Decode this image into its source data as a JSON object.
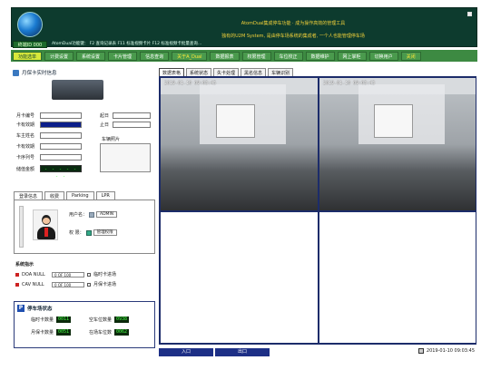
{
  "header": {
    "device_id": "终端ID 000",
    "banner_line1": "AtomDual集成停车功能 · 成为操作高效的管理工具",
    "banner_line2": "独有的U2M System, 是由停车场系统的集成者, 一个人也能管理停车场",
    "ticker": "AtomDual功能键：  F2 查询记录表  F11 标准视频卡片   F12 标准视频卡批量查询..."
  },
  "nav": {
    "items": [
      {
        "label": "功能选单",
        "state": "active"
      },
      {
        "label": "计费设置",
        "state": "normal"
      },
      {
        "label": "系统设置",
        "state": "normal"
      },
      {
        "label": "卡片管理",
        "state": "normal"
      },
      {
        "label": "信息查询",
        "state": "normal"
      },
      {
        "label": "关于A_Dual",
        "state": "yellow"
      },
      {
        "label": "数据报表",
        "state": "normal"
      },
      {
        "label": "权限管理",
        "state": "normal"
      },
      {
        "label": "车位校正",
        "state": "normal"
      },
      {
        "label": "数据维护",
        "state": "normal"
      },
      {
        "label": "网上掌柜",
        "state": "normal"
      },
      {
        "label": "切换用户",
        "state": "normal"
      },
      {
        "label": "关闭",
        "state": "yellow"
      }
    ]
  },
  "left": {
    "section_title": "月保卡实时信息",
    "fields": {
      "card_no": "月卡编号",
      "card_status": "卡有效期",
      "owner": "车主姓名",
      "valid": "卡有效期",
      "serial": "卡序列号",
      "balance": "储值金额",
      "start": "起日",
      "end": "止日",
      "photo": "车辆照片",
      "balance_value": "- - - - - - -"
    },
    "tabs": [
      "登录信息",
      "收费",
      "Parking",
      "LPR"
    ],
    "login": {
      "user_label": "用户名：",
      "user_value": "ADMIN",
      "perm_label": "权  限：",
      "perm_value": "管理权限"
    },
    "system": {
      "title": "系统指示",
      "rows": [
        {
          "name": "DOA NULL",
          "value": "0 OF 100",
          "check": "临时卡进场"
        },
        {
          "name": "CAV NULL",
          "value": "0 OF 100",
          "check": "月保卡进场"
        }
      ]
    },
    "parking": {
      "title": "停车场状态",
      "temp_in_label": "临时卡数量",
      "temp_in": "0011",
      "space_label": "空车位数量",
      "space": "0938",
      "month_label": "月保卡数量",
      "month": "0051",
      "occupied_label": "在场车位数",
      "occupied": "0062"
    }
  },
  "cameras": {
    "tabs": [
      "数据表格",
      "系统状态",
      "失卡处理",
      "黑名信息",
      "车辆识别"
    ],
    "cam1_ts": "2019-01-10 09:03:45",
    "cam2_ts": "2019-01-10 09:03:43"
  },
  "bottom": {
    "entry": "入口",
    "exit": "出口",
    "clock": "2019-01-10 09:03:45"
  }
}
